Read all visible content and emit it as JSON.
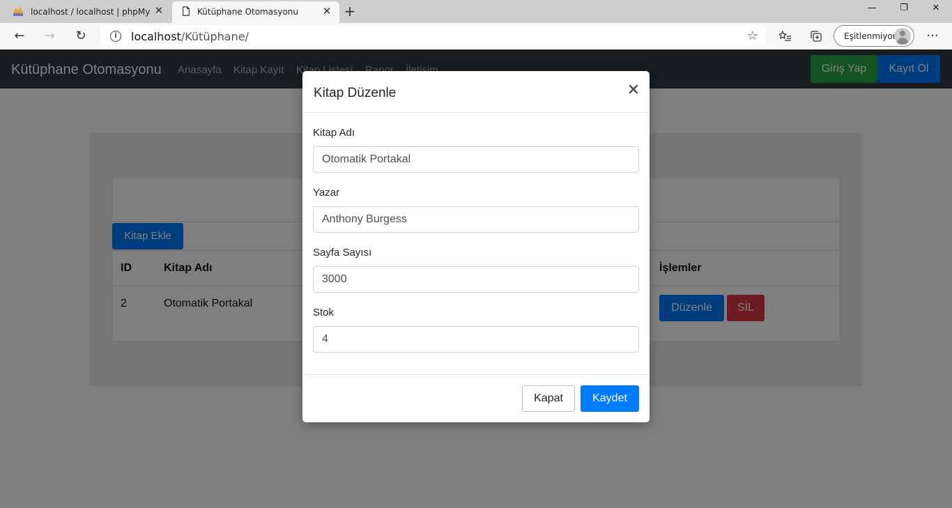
{
  "browser": {
    "tabs": [
      {
        "title": "localhost / localhost | phpMyAdmin",
        "favicon": "phpmyadmin-icon",
        "active": false
      },
      {
        "title": "Kütüphane Otomasyonu",
        "favicon": "page-icon",
        "active": true
      }
    ],
    "url_host": "localhost",
    "url_path": "/Kütüphane/",
    "profile_label": "Eşitlenmiyor",
    "window_controls": {
      "minimize": "—",
      "restore": "❐",
      "close": "✕"
    }
  },
  "navbar": {
    "brand": "Kütüphane Otomasyonu",
    "links": [
      "Anasayfa",
      "Kitap Kayıt",
      "Kitap Listesi",
      "Rapor",
      "İletişim"
    ],
    "login_label": "Giriş Yap",
    "register_label": "Kayıt Ol",
    "colors": {
      "navbar_bg": "#343a40",
      "login_bg": "#28a745",
      "register_bg": "#007bff"
    }
  },
  "main": {
    "add_button_label": "Kitap Ekle",
    "table": {
      "headers": {
        "id": "ID",
        "name": "Kitap Adı",
        "actions": "İşlemler"
      },
      "rows": [
        {
          "id": "2",
          "name": "Otomatik Portakal",
          "edit_label": "Düzenle",
          "delete_label": "SİL"
        }
      ]
    }
  },
  "modal": {
    "title": "Kitap Düzenle",
    "close_glyph": "×",
    "fields": [
      {
        "label": "Kitap Adı",
        "value": "Otomatik Portakal"
      },
      {
        "label": "Yazar",
        "value": "Anthony Burgess"
      },
      {
        "label": "Sayfa Sayısı",
        "value": "3000"
      },
      {
        "label": "Stok",
        "value": "4"
      }
    ],
    "close_button": "Kapat",
    "save_button": "Kaydet",
    "colors": {
      "primary": "#007bff",
      "danger": "#dc3545"
    }
  }
}
